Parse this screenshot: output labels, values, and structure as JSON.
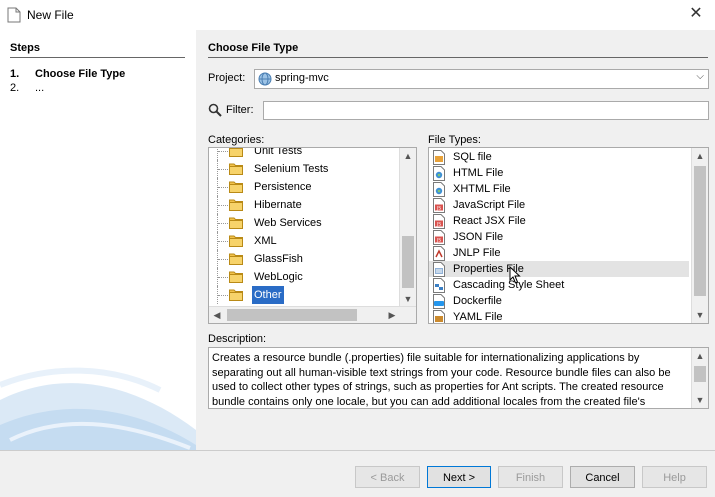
{
  "window": {
    "title": "New File"
  },
  "steps": {
    "heading": "Steps",
    "items": [
      {
        "num": "1.",
        "label": "Choose File Type"
      },
      {
        "num": "2.",
        "label": "..."
      }
    ]
  },
  "main": {
    "heading": "Choose File Type",
    "project_label": "Project:",
    "project_value": "spring-mvc",
    "filter_label": "Filter:",
    "filter_value": "",
    "categories_label": "Categories:",
    "file_types_label": "File Types:",
    "description_label": "Description:",
    "description": "Creates a resource bundle (.properties) file suitable for internationalizing applications by separating out all human-visible text strings from your code. Resource bundle files can also be used to collect other types of strings, such as properties for Ant scripts. The created resource bundle contains only one locale, but you can add additional locales from the created file's"
  },
  "categories": [
    {
      "label": "Unit Tests"
    },
    {
      "label": "Selenium Tests"
    },
    {
      "label": "Persistence"
    },
    {
      "label": "Hibernate"
    },
    {
      "label": "Web Services"
    },
    {
      "label": "XML"
    },
    {
      "label": "GlassFish"
    },
    {
      "label": "WebLogic"
    },
    {
      "label": "Other",
      "selected": true
    }
  ],
  "file_types": [
    {
      "label": "SQL file",
      "icon": "sql-file-icon"
    },
    {
      "label": "HTML File",
      "icon": "html-file-icon"
    },
    {
      "label": "XHTML File",
      "icon": "xhtml-file-icon"
    },
    {
      "label": "JavaScript File",
      "icon": "javascript-file-icon"
    },
    {
      "label": "React JSX File",
      "icon": "jsx-file-icon"
    },
    {
      "label": "JSON File",
      "icon": "json-file-icon"
    },
    {
      "label": "JNLP File",
      "icon": "jnlp-file-icon"
    },
    {
      "label": "Properties File",
      "icon": "properties-file-icon",
      "highlighted": true
    },
    {
      "label": "Cascading Style Sheet",
      "icon": "css-file-icon"
    },
    {
      "label": "Dockerfile",
      "icon": "docker-file-icon"
    },
    {
      "label": "YAML File",
      "icon": "yaml-file-icon"
    }
  ],
  "buttons": {
    "back": "< Back",
    "next": "Next >",
    "finish": "Finish",
    "cancel": "Cancel",
    "help": "Help"
  },
  "colors": {
    "selection": "#2a6cc6",
    "panel_bg": "#f0f0f0",
    "default_button_border": "#0078d7"
  }
}
